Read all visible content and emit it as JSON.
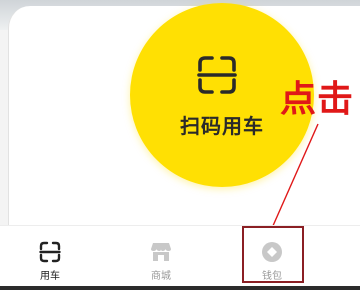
{
  "main": {
    "scan_label": "扫码用车",
    "scan_icon": "scan-icon",
    "accent_color": "#ffe003"
  },
  "annotation": {
    "text": "点击",
    "color": "#e01818",
    "box_color": "#8b1f24"
  },
  "tabbar": {
    "tabs": [
      {
        "label": "用车",
        "icon": "scan-icon",
        "active": true
      },
      {
        "label": "商城",
        "icon": "shop-icon",
        "active": false
      },
      {
        "label": "钱包",
        "icon": "wallet-icon",
        "active": false
      }
    ]
  }
}
